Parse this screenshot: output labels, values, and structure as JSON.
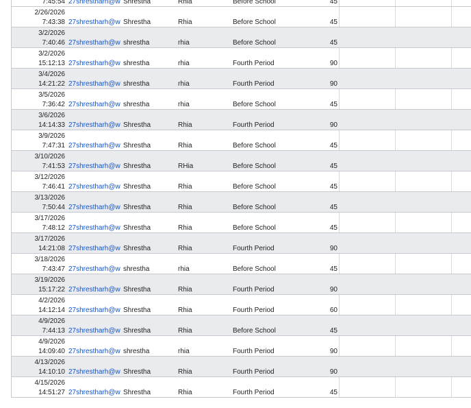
{
  "rows": [
    {
      "date": "2/26/2026",
      "time": "7:43:38",
      "email": "27shrestharh@w",
      "last": "Shrestha",
      "first": "Rhia",
      "period": "Before School",
      "minutes": "45"
    },
    {
      "date": "3/2/2026",
      "time": "7:40:46",
      "email": "27shrestharh@w",
      "last": "shrestha",
      "first": "rhia",
      "period": "Before School",
      "minutes": "45"
    },
    {
      "date": "3/2/2026",
      "time": "15:12:13",
      "email": "27shrestharh@w",
      "last": "shrestha",
      "first": "rhia",
      "period": "Fourth Period",
      "minutes": "90"
    },
    {
      "date": "3/4/2026",
      "time": "14:21:22",
      "email": "27shrestharh@w",
      "last": "shrestha",
      "first": "rhia",
      "period": "Fourth Period",
      "minutes": "90"
    },
    {
      "date": "3/5/2026",
      "time": "7:36:42",
      "email": "27shrestharh@w",
      "last": "shrestha",
      "first": "rhia",
      "period": "Before School",
      "minutes": "45"
    },
    {
      "date": "3/6/2026",
      "time": "14:14:33",
      "email": "27shrestharh@w",
      "last": "Shrestha",
      "first": "Rhia",
      "period": "Fourth Period",
      "minutes": "90"
    },
    {
      "date": "3/9/2026",
      "time": "7:47:31",
      "email": "27shrestharh@w",
      "last": "Shrestha",
      "first": "Rhia",
      "period": "Before School",
      "minutes": "45"
    },
    {
      "date": "3/10/2026",
      "time": "7:41:53",
      "email": "27shrestharh@w",
      "last": "Shrestha",
      "first": "RHia",
      "period": "Before School",
      "minutes": "45"
    },
    {
      "date": "3/12/2026",
      "time": "7:46:41",
      "email": "27shrestharh@w",
      "last": "Shrestha",
      "first": "Rhia",
      "period": "Before School",
      "minutes": "45"
    },
    {
      "date": "3/13/2026",
      "time": "7:50:44",
      "email": "27shrestharh@w",
      "last": "Shrestha",
      "first": "Rhia",
      "period": "Before School",
      "minutes": "45"
    },
    {
      "date": "3/17/2026",
      "time": "7:48:12",
      "email": "27shrestharh@w",
      "last": "Shrestha",
      "first": "Rhia",
      "period": "Before School",
      "minutes": "45"
    },
    {
      "date": "3/17/2026",
      "time": "14:21:08",
      "email": "27shrestharh@w",
      "last": "Shrestha",
      "first": "Rhia",
      "period": "Fourth Period",
      "minutes": "90"
    },
    {
      "date": "3/18/2026",
      "time": "7:43:47",
      "email": "27shrestharh@w",
      "last": "shrestha",
      "first": "rhia",
      "period": "Before School",
      "minutes": "45"
    },
    {
      "date": "3/19/2026",
      "time": "15:17:22",
      "email": "27shrestharh@w",
      "last": "Shrestha",
      "first": "Rhia",
      "period": "Fourth Period",
      "minutes": "90"
    },
    {
      "date": "4/2/2026",
      "time": "14:12:14",
      "email": "27shrestharh@w",
      "last": "Shrestha",
      "first": "Rhia",
      "period": "Fourth Period",
      "minutes": "60"
    },
    {
      "date": "4/9/2026",
      "time": "7:44:13",
      "email": "27shrestharh@w",
      "last": "Shrestha",
      "first": "Rhia",
      "period": "Before School",
      "minutes": "45"
    },
    {
      "date": "4/9/2026",
      "time": "14:09:40",
      "email": "27shrestharh@w",
      "last": "shrestha",
      "first": "rhia",
      "period": "Fourth Period",
      "minutes": "90"
    },
    {
      "date": "4/13/2026",
      "time": "14:10:10",
      "email": "27shrestharh@w",
      "last": "Shrestha",
      "first": "Rhia",
      "period": "Fourth Period",
      "minutes": "90"
    },
    {
      "date": "4/15/2026",
      "time": "14:51:27",
      "email": "27shrestharh@w",
      "last": "Shrestha",
      "first": "Rhia",
      "period": "Fourth Period",
      "minutes": "45"
    }
  ],
  "partial_top_row": {
    "time": "7:45:54",
    "email": "27shrestharh@w",
    "last": "Shrestha",
    "first": "Rhia",
    "period": "Before School",
    "minutes": "45"
  }
}
